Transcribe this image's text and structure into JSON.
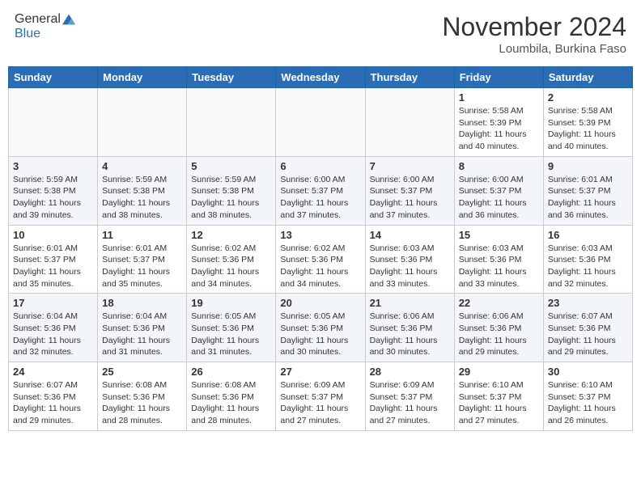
{
  "header": {
    "logo_line1": "General",
    "logo_line2": "Blue",
    "month": "November 2024",
    "location": "Loumbila, Burkina Faso"
  },
  "days_of_week": [
    "Sunday",
    "Monday",
    "Tuesday",
    "Wednesday",
    "Thursday",
    "Friday",
    "Saturday"
  ],
  "weeks": [
    [
      {
        "day": "",
        "empty": true
      },
      {
        "day": "",
        "empty": true
      },
      {
        "day": "",
        "empty": true
      },
      {
        "day": "",
        "empty": true
      },
      {
        "day": "",
        "empty": true
      },
      {
        "day": "1",
        "sunrise": "5:58 AM",
        "sunset": "5:39 PM",
        "daylight": "11 hours and 40 minutes."
      },
      {
        "day": "2",
        "sunrise": "5:58 AM",
        "sunset": "5:39 PM",
        "daylight": "11 hours and 40 minutes."
      }
    ],
    [
      {
        "day": "3",
        "sunrise": "5:59 AM",
        "sunset": "5:38 PM",
        "daylight": "11 hours and 39 minutes."
      },
      {
        "day": "4",
        "sunrise": "5:59 AM",
        "sunset": "5:38 PM",
        "daylight": "11 hours and 38 minutes."
      },
      {
        "day": "5",
        "sunrise": "5:59 AM",
        "sunset": "5:38 PM",
        "daylight": "11 hours and 38 minutes."
      },
      {
        "day": "6",
        "sunrise": "6:00 AM",
        "sunset": "5:37 PM",
        "daylight": "11 hours and 37 minutes."
      },
      {
        "day": "7",
        "sunrise": "6:00 AM",
        "sunset": "5:37 PM",
        "daylight": "11 hours and 37 minutes."
      },
      {
        "day": "8",
        "sunrise": "6:00 AM",
        "sunset": "5:37 PM",
        "daylight": "11 hours and 36 minutes."
      },
      {
        "day": "9",
        "sunrise": "6:01 AM",
        "sunset": "5:37 PM",
        "daylight": "11 hours and 36 minutes."
      }
    ],
    [
      {
        "day": "10",
        "sunrise": "6:01 AM",
        "sunset": "5:37 PM",
        "daylight": "11 hours and 35 minutes."
      },
      {
        "day": "11",
        "sunrise": "6:01 AM",
        "sunset": "5:37 PM",
        "daylight": "11 hours and 35 minutes."
      },
      {
        "day": "12",
        "sunrise": "6:02 AM",
        "sunset": "5:36 PM",
        "daylight": "11 hours and 34 minutes."
      },
      {
        "day": "13",
        "sunrise": "6:02 AM",
        "sunset": "5:36 PM",
        "daylight": "11 hours and 34 minutes."
      },
      {
        "day": "14",
        "sunrise": "6:03 AM",
        "sunset": "5:36 PM",
        "daylight": "11 hours and 33 minutes."
      },
      {
        "day": "15",
        "sunrise": "6:03 AM",
        "sunset": "5:36 PM",
        "daylight": "11 hours and 33 minutes."
      },
      {
        "day": "16",
        "sunrise": "6:03 AM",
        "sunset": "5:36 PM",
        "daylight": "11 hours and 32 minutes."
      }
    ],
    [
      {
        "day": "17",
        "sunrise": "6:04 AM",
        "sunset": "5:36 PM",
        "daylight": "11 hours and 32 minutes."
      },
      {
        "day": "18",
        "sunrise": "6:04 AM",
        "sunset": "5:36 PM",
        "daylight": "11 hours and 31 minutes."
      },
      {
        "day": "19",
        "sunrise": "6:05 AM",
        "sunset": "5:36 PM",
        "daylight": "11 hours and 31 minutes."
      },
      {
        "day": "20",
        "sunrise": "6:05 AM",
        "sunset": "5:36 PM",
        "daylight": "11 hours and 30 minutes."
      },
      {
        "day": "21",
        "sunrise": "6:06 AM",
        "sunset": "5:36 PM",
        "daylight": "11 hours and 30 minutes."
      },
      {
        "day": "22",
        "sunrise": "6:06 AM",
        "sunset": "5:36 PM",
        "daylight": "11 hours and 29 minutes."
      },
      {
        "day": "23",
        "sunrise": "6:07 AM",
        "sunset": "5:36 PM",
        "daylight": "11 hours and 29 minutes."
      }
    ],
    [
      {
        "day": "24",
        "sunrise": "6:07 AM",
        "sunset": "5:36 PM",
        "daylight": "11 hours and 29 minutes."
      },
      {
        "day": "25",
        "sunrise": "6:08 AM",
        "sunset": "5:36 PM",
        "daylight": "11 hours and 28 minutes."
      },
      {
        "day": "26",
        "sunrise": "6:08 AM",
        "sunset": "5:36 PM",
        "daylight": "11 hours and 28 minutes."
      },
      {
        "day": "27",
        "sunrise": "6:09 AM",
        "sunset": "5:37 PM",
        "daylight": "11 hours and 27 minutes."
      },
      {
        "day": "28",
        "sunrise": "6:09 AM",
        "sunset": "5:37 PM",
        "daylight": "11 hours and 27 minutes."
      },
      {
        "day": "29",
        "sunrise": "6:10 AM",
        "sunset": "5:37 PM",
        "daylight": "11 hours and 27 minutes."
      },
      {
        "day": "30",
        "sunrise": "6:10 AM",
        "sunset": "5:37 PM",
        "daylight": "11 hours and 26 minutes."
      }
    ]
  ],
  "labels": {
    "sunrise_prefix": "Sunrise: ",
    "sunset_prefix": "Sunset: ",
    "daylight_prefix": "Daylight: "
  }
}
